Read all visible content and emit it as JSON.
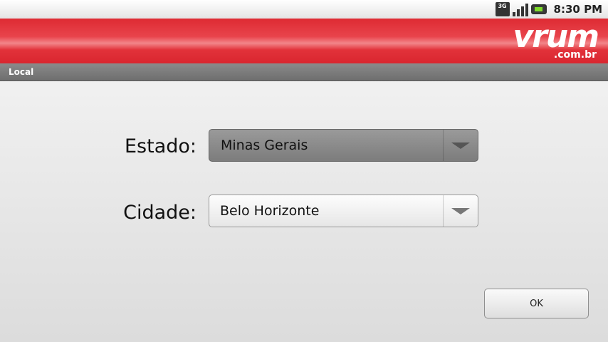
{
  "status_bar": {
    "network": "3G",
    "time": "8:30 PM"
  },
  "banner": {
    "logo_word": "vrum",
    "logo_domain": ".com.br",
    "brand_color": "#de2b33"
  },
  "title_bar": {
    "title": "Local"
  },
  "form": {
    "estado_label": "Estado:",
    "estado_value": "Minas Gerais",
    "cidade_label": "Cidade:",
    "cidade_value": "Belo Horizonte"
  },
  "actions": {
    "ok_label": "OK"
  }
}
